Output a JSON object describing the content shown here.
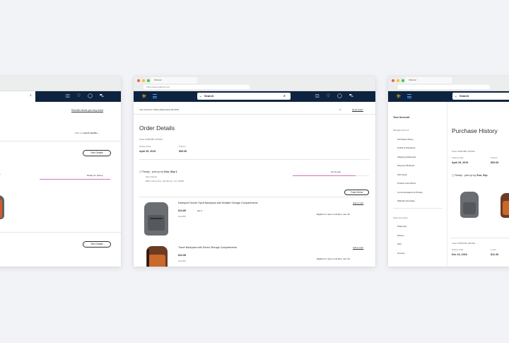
{
  "left": {
    "reorder_link": "Reorder items you buy most",
    "filter_prefix": "Filter by",
    "filter_value": "Last 6 months",
    "see_details_1": "See Details",
    "status": "Ready for pickup",
    "see_details_2": "See Details",
    "progress": 1.0
  },
  "center": {
    "tab_title": "Walmart",
    "url": "https://www.walmart.com",
    "search_placeholder": "Search",
    "breadcrumb": "Your Account / Order placed April 29 2019",
    "need_help": "Need Help?",
    "title": "Order Details",
    "order_number": "Order #5051887-875520",
    "order_date_label": "Online order",
    "order_date": "April 29, 2019",
    "total_label": "5 items",
    "total": "$53.08",
    "pickup_prefix": "Ready - pick up by",
    "pickup_date": "Sun, Sep 1",
    "store_name": "San Antonio",
    "store_address": "8061 Cherry Ave, San Bruno, CA, 94066",
    "on_its_way": "On its way",
    "progress": 0.82,
    "track_items": "Track Items",
    "item1": {
      "name": "Eastsport Deluxe Sport Backpack with Multiple Storage Compartments",
      "price": "$13.89",
      "each": "1/ea 8/6",
      "qty": "Qty 2",
      "add_to_cart": "Add to Cart",
      "return": "Eligible for return until Mon, Nov 26"
    },
    "item2": {
      "name": "Travel Backpack with Seven Storage Compartments",
      "price": "$24.98",
      "each": "1/ea 8/6",
      "add_to_cart": "Add to Cart",
      "return": "Eligible for return until Mon, Nov 26"
    }
  },
  "right": {
    "tab_title": "Walmart",
    "search_placeholder": "Search",
    "account_title": "Your Account",
    "menu": [
      "Manage Account",
      "Purchase History",
      "Profile & Password",
      "Shipping Addresses",
      "Payment Methods",
      "Gift Cards",
      "Product Care Plans",
      "Communications & Privacy",
      "Walmart Associate"
    ],
    "other_accounts": "Other Accounts",
    "other_menu": [
      "Pharmacy",
      "Photos",
      "Kids",
      "Grocery"
    ],
    "title": "Purchase History",
    "order_number": "Order #5051887-875520",
    "order_date_label": "Online order",
    "order_date": "April 29, 2019",
    "total_label": "5 items",
    "total": "$53.08",
    "pickup_prefix": "Ready - pick up by",
    "pickup_date": "Sun, Sep",
    "order2_number": "Order #5050789-285398",
    "order2_date_label": "Online order",
    "order2_date": "Dec 16, 2018",
    "order2_total_label": "1 item",
    "order2_total": "$12.45"
  },
  "colors": {
    "navy": "#0d2340",
    "spark": "#ffc220",
    "progress": "#d471c4"
  }
}
